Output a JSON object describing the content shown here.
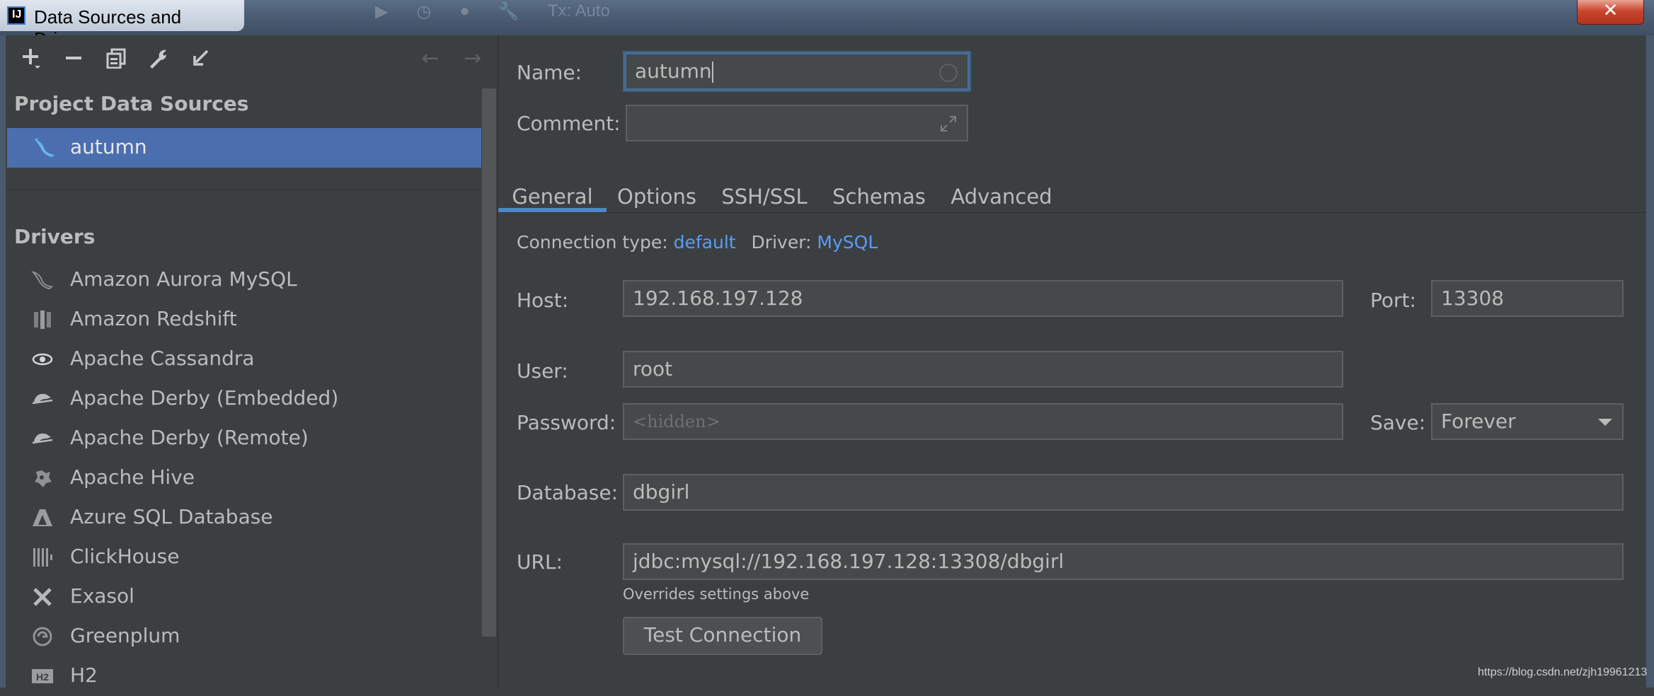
{
  "window": {
    "title": "Data Sources and Drivers",
    "close_label": "✕"
  },
  "background_toolbar": {
    "tx_label": "Tx: Auto"
  },
  "left_toolbar": {
    "add_label": "+",
    "remove_label": "−"
  },
  "sidebar": {
    "project_header": "Project Data Sources",
    "data_sources": [
      {
        "label": "autumn",
        "icon": "mysql-dolphin-icon"
      }
    ],
    "drivers_header": "Drivers",
    "drivers": [
      {
        "label": "Amazon Aurora MySQL",
        "icon": "aurora-icon"
      },
      {
        "label": "Amazon Redshift",
        "icon": "redshift-icon"
      },
      {
        "label": "Apache Cassandra",
        "icon": "cassandra-icon"
      },
      {
        "label": "Apache Derby (Embedded)",
        "icon": "derby-icon"
      },
      {
        "label": "Apache Derby (Remote)",
        "icon": "derby-icon"
      },
      {
        "label": "Apache Hive",
        "icon": "hive-icon"
      },
      {
        "label": "Azure SQL Database",
        "icon": "azure-icon"
      },
      {
        "label": "ClickHouse",
        "icon": "clickhouse-icon"
      },
      {
        "label": "Exasol",
        "icon": "exasol-icon"
      },
      {
        "label": "Greenplum",
        "icon": "greenplum-icon"
      },
      {
        "label": "H2",
        "icon": "h2-icon"
      }
    ]
  },
  "form": {
    "name_label": "Name:",
    "name_value": "autumn",
    "comment_label": "Comment:",
    "comment_value": "",
    "tabs": [
      "General",
      "Options",
      "SSH/SSL",
      "Schemas",
      "Advanced"
    ],
    "active_tab": "General",
    "connection_type_label": "Connection type:",
    "connection_type_value": "default",
    "driver_label": "Driver:",
    "driver_value": "MySQL",
    "host_label": "Host:",
    "host_value": "192.168.197.128",
    "port_label": "Port:",
    "port_value": "13308",
    "user_label": "User:",
    "user_value": "root",
    "password_label": "Password:",
    "password_placeholder": "<hidden>",
    "save_label": "Save:",
    "save_value": "Forever",
    "database_label": "Database:",
    "database_value": "dbgirl",
    "url_label": "URL:",
    "url_value": "jdbc:mysql://192.168.197.128:13308/dbgirl",
    "url_hint": "Overrides settings above",
    "test_connection_label": "Test Connection"
  },
  "watermark": "https://blog.csdn.net/zjh19961213",
  "colors": {
    "selection": "#4b6eaf",
    "link": "#589df6",
    "tab_underline": "#4a88c7",
    "panel_bg": "#3c3f41"
  }
}
